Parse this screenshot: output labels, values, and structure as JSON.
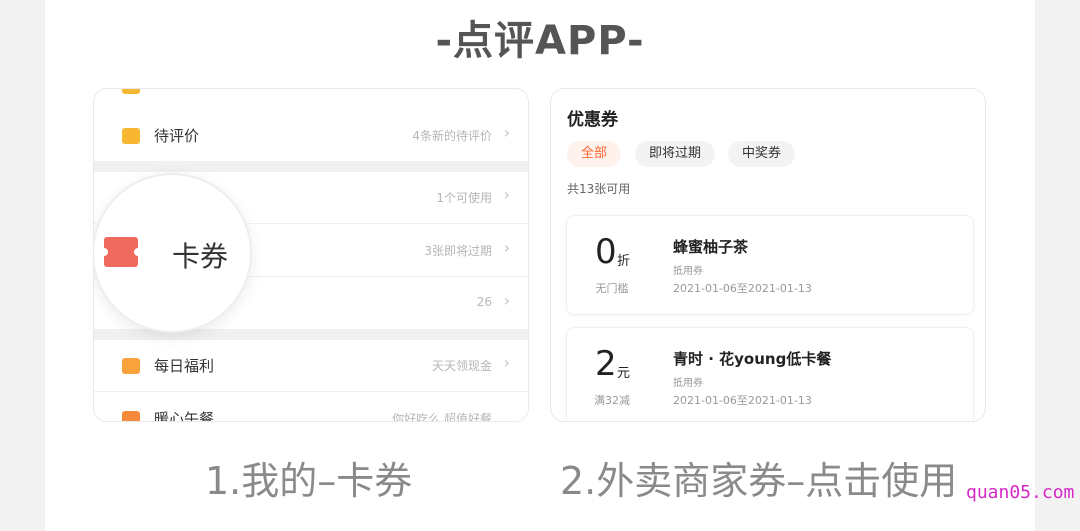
{
  "title": "-点评APP-",
  "left_panel": {
    "rows": [
      {
        "label": "待评价",
        "hint": "4条新的待评价"
      },
      {
        "label": "",
        "hint": "1个可使用"
      },
      {
        "label": "",
        "hint": "3张即将过期"
      },
      {
        "label": "",
        "hint": "26"
      },
      {
        "label": "每日福利",
        "hint": "天天领现金"
      },
      {
        "label": "暖心午餐",
        "hint": "你好吃么 超值好餐"
      }
    ],
    "magnified_label": "卡券",
    "chevron": "›"
  },
  "right_panel": {
    "title": "优惠券",
    "tabs": [
      "全部",
      "即将过期",
      "中奖券"
    ],
    "active_tab": "全部",
    "count_text": "共13张可用",
    "coupons": [
      {
        "amount": "0",
        "unit": "折",
        "condition": "无门槛",
        "name": "蜂蜜柚子茶",
        "type": "抵用券",
        "date_range": "2021-01-06至2021-01-13"
      },
      {
        "amount": "2",
        "unit": "元",
        "condition": "满32减",
        "name": "青时 · 花young低卡餐",
        "type": "抵用券",
        "date_range": "2021-01-06至2021-01-13"
      }
    ]
  },
  "captions": {
    "left": "1.我的–卡券",
    "right": "2.外卖商家券–点击使用"
  },
  "watermark": "quan05.com",
  "colors": {
    "accent": "#ff6633",
    "ticket": "#f0695f",
    "watermark": "#d628c6"
  }
}
